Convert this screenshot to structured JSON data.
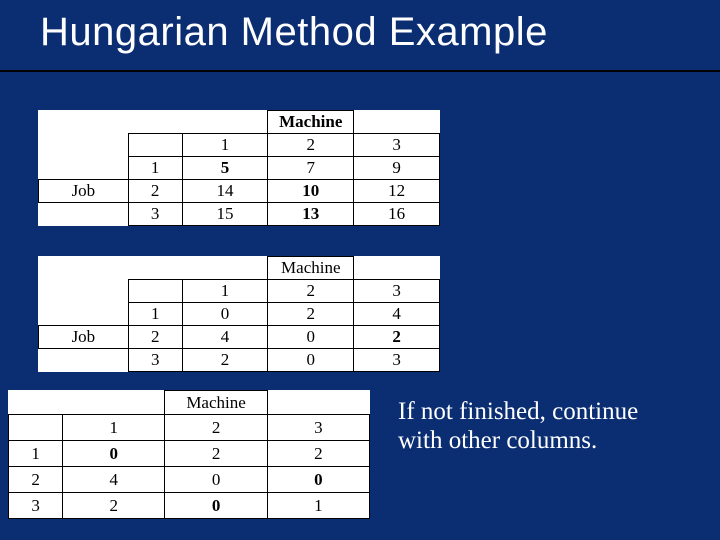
{
  "title": "Hungarian Method Example",
  "labels": {
    "machine": "Machine",
    "job": "Job"
  },
  "note": "If not finished, continue with other columns.",
  "tables": [
    {
      "machine_cols": [
        "1",
        "2",
        "3"
      ],
      "rows": [
        {
          "job": "1",
          "cells": [
            {
              "v": "5",
              "bold": true
            },
            {
              "v": "7"
            },
            {
              "v": "9"
            }
          ]
        },
        {
          "job": "2",
          "cells": [
            {
              "v": "14"
            },
            {
              "v": "10",
              "bold": true
            },
            {
              "v": "12"
            }
          ]
        },
        {
          "job": "3",
          "cells": [
            {
              "v": "15"
            },
            {
              "v": "13",
              "bold": true
            },
            {
              "v": "16"
            }
          ]
        }
      ]
    },
    {
      "machine_cols": [
        "1",
        "2",
        "3"
      ],
      "rows": [
        {
          "job": "1",
          "cells": [
            {
              "v": "0"
            },
            {
              "v": "2"
            },
            {
              "v": "4"
            }
          ]
        },
        {
          "job": "2",
          "cells": [
            {
              "v": "4"
            },
            {
              "v": "0"
            },
            {
              "v": "2",
              "bold": true
            }
          ]
        },
        {
          "job": "3",
          "cells": [
            {
              "v": "2"
            },
            {
              "v": "0"
            },
            {
              "v": "3"
            }
          ]
        }
      ]
    },
    {
      "machine_cols": [
        "1",
        "2",
        "3"
      ],
      "rows": [
        {
          "job": "1",
          "cells": [
            {
              "v": "0",
              "bold": true
            },
            {
              "v": "2"
            },
            {
              "v": "2"
            }
          ]
        },
        {
          "job": "2",
          "cells": [
            {
              "v": "4"
            },
            {
              "v": "0"
            },
            {
              "v": "0",
              "bold": true
            }
          ]
        },
        {
          "job": "3",
          "cells": [
            {
              "v": "2"
            },
            {
              "v": "0",
              "bold": true
            },
            {
              "v": "1"
            }
          ]
        }
      ]
    }
  ],
  "chart_data": [
    {
      "type": "table",
      "title": "Original cost matrix",
      "row_label": "Job",
      "col_label": "Machine",
      "columns": [
        "1",
        "2",
        "3"
      ],
      "rows": [
        "1",
        "2",
        "3"
      ],
      "values": [
        [
          5,
          7,
          9
        ],
        [
          14,
          10,
          12
        ],
        [
          15,
          13,
          16
        ]
      ],
      "highlighted": [
        [
          0,
          0
        ],
        [
          1,
          1
        ],
        [
          2,
          1
        ]
      ]
    },
    {
      "type": "table",
      "title": "After row reduction",
      "row_label": "Job",
      "col_label": "Machine",
      "columns": [
        "1",
        "2",
        "3"
      ],
      "rows": [
        "1",
        "2",
        "3"
      ],
      "values": [
        [
          0,
          2,
          4
        ],
        [
          4,
          0,
          2
        ],
        [
          2,
          0,
          3
        ]
      ],
      "highlighted": [
        [
          1,
          2
        ]
      ]
    },
    {
      "type": "table",
      "title": "After column reduction",
      "col_label": "Machine",
      "columns": [
        "1",
        "2",
        "3"
      ],
      "rows": [
        "1",
        "2",
        "3"
      ],
      "values": [
        [
          0,
          2,
          2
        ],
        [
          4,
          0,
          0
        ],
        [
          2,
          0,
          1
        ]
      ],
      "highlighted": [
        [
          0,
          0
        ],
        [
          1,
          2
        ],
        [
          2,
          1
        ]
      ]
    }
  ]
}
